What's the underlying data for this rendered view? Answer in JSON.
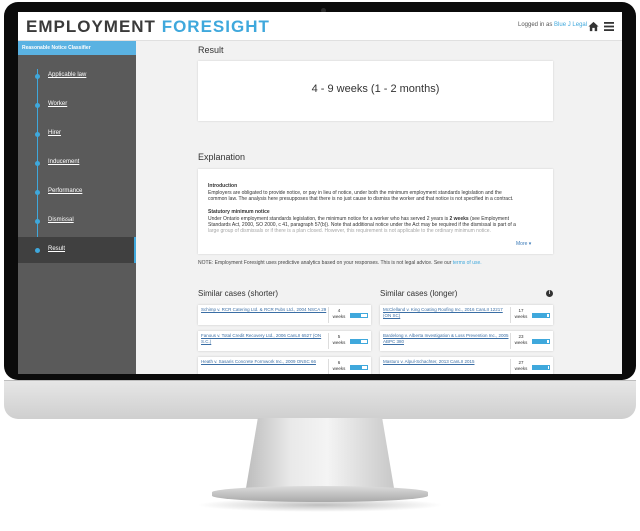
{
  "header": {
    "brand_part1": "EMPLOYMENT",
    "brand_part2": "FORESIGHT",
    "login_prefix": "Logged in as",
    "login_user": "Blue J Legal",
    "icons": [
      "home-icon",
      "menu-icon"
    ]
  },
  "sidebar": {
    "title": "Reasonable Notice Classifier",
    "items": [
      {
        "label": "Applicable law"
      },
      {
        "label": "Worker"
      },
      {
        "label": "Hirer"
      },
      {
        "label": "Inducement"
      },
      {
        "label": "Performance"
      },
      {
        "label": "Dismissal"
      },
      {
        "label": "Result",
        "active": true
      }
    ]
  },
  "result": {
    "heading": "Result",
    "value": "4 - 9 weeks (1 - 2 months)"
  },
  "explanation": {
    "heading": "Explanation",
    "intro_title": "Introduction",
    "intro_line1": "Employers are obligated to provide notice, or pay in lieu of notice, under both the minimum employment standards legislation and the",
    "intro_line2": "common law. The analysis here presupposes that there is no just cause to dismiss the worker and that notice is not specified in a contract.",
    "stat_title": "Statutory minimum notice",
    "stat_line1_a": "Under Ontario employment standards legislation, the minimum notice for a worker who has served 2 years is",
    "stat_line1_b": "2 weeks",
    "stat_line1_c": "(see Employment",
    "stat_line2": "Standards Act, 2000, SO 2000, c 41, paragraph 57(b)). Note that additional notice under the Act may be required if the dismissal is part of a",
    "stat_line3": "large group of dismissals or if there is a plan closed. However, this requirement is not applicable to the ordinary minimum notice.",
    "more": "More ▾"
  },
  "note": {
    "text": "NOTE: Employment Foresight uses predictive analytics based on your responses. This is not legal advice. See our",
    "link": "terms of use."
  },
  "similar_shorter": {
    "heading": "Similar cases (shorter)",
    "cases": [
      {
        "name": "Schimp v. RCR Catering Ltd. & RCR Pubs Ltd., 2004 NSCA 29",
        "weeks": "4",
        "unit": "weeks",
        "fill": 0.6
      },
      {
        "name": "Fanous v. Total Credit Recovery Ltd., 2006 CanLII 6527 (ON S.C.)",
        "weeks": "5",
        "unit": "weeks",
        "fill": 0.65
      },
      {
        "name": "Heath v. Sasaris Concrete Formwork Inc., 2009 ONSC 66",
        "weeks": "6",
        "unit": "weeks",
        "fill": 0.7
      }
    ]
  },
  "similar_longer": {
    "heading": "Similar cases (longer)",
    "cases": [
      {
        "name": "McClelland v. King Coating Roofing Inc., 2016 CanLII 12217 (ON SC)",
        "weeks": "17",
        "unit": "weeks",
        "fill": 0.85
      },
      {
        "name": "Bardelong v. Alberta Investigation & Loss Prevention Inc., 2005 ABPC 380",
        "weeks": "23",
        "unit": "weeks",
        "fill": 0.9
      },
      {
        "name": "Masturo v. Alpul-Schachter, 2013 CanLII 2015",
        "weeks": "27",
        "unit": "weeks",
        "fill": 0.95
      }
    ]
  },
  "colors": {
    "accent": "#3fa8dc",
    "sidebar_bg": "#5a5a5a",
    "sidebar_active": "#404040"
  }
}
